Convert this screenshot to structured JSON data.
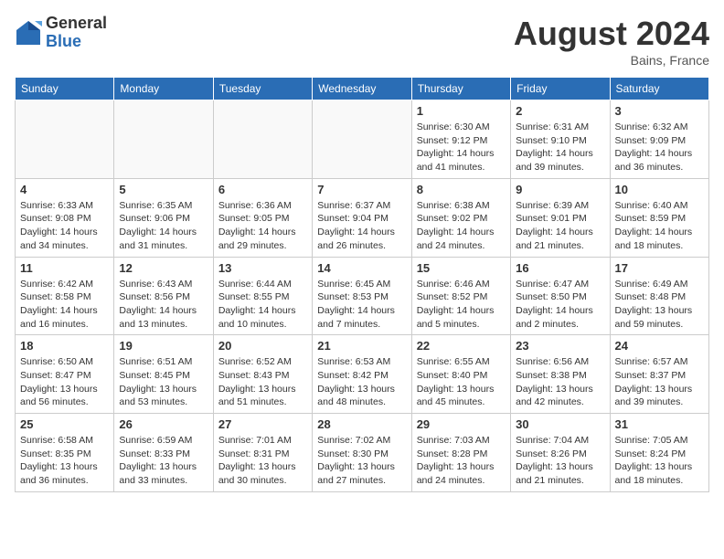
{
  "logo": {
    "general": "General",
    "blue": "Blue"
  },
  "title": "August 2024",
  "location": "Bains, France",
  "days_of_week": [
    "Sunday",
    "Monday",
    "Tuesday",
    "Wednesday",
    "Thursday",
    "Friday",
    "Saturday"
  ],
  "weeks": [
    [
      {
        "day": "",
        "info": ""
      },
      {
        "day": "",
        "info": ""
      },
      {
        "day": "",
        "info": ""
      },
      {
        "day": "",
        "info": ""
      },
      {
        "day": "1",
        "info": "Sunrise: 6:30 AM\nSunset: 9:12 PM\nDaylight: 14 hours\nand 41 minutes."
      },
      {
        "day": "2",
        "info": "Sunrise: 6:31 AM\nSunset: 9:10 PM\nDaylight: 14 hours\nand 39 minutes."
      },
      {
        "day": "3",
        "info": "Sunrise: 6:32 AM\nSunset: 9:09 PM\nDaylight: 14 hours\nand 36 minutes."
      }
    ],
    [
      {
        "day": "4",
        "info": "Sunrise: 6:33 AM\nSunset: 9:08 PM\nDaylight: 14 hours\nand 34 minutes."
      },
      {
        "day": "5",
        "info": "Sunrise: 6:35 AM\nSunset: 9:06 PM\nDaylight: 14 hours\nand 31 minutes."
      },
      {
        "day": "6",
        "info": "Sunrise: 6:36 AM\nSunset: 9:05 PM\nDaylight: 14 hours\nand 29 minutes."
      },
      {
        "day": "7",
        "info": "Sunrise: 6:37 AM\nSunset: 9:04 PM\nDaylight: 14 hours\nand 26 minutes."
      },
      {
        "day": "8",
        "info": "Sunrise: 6:38 AM\nSunset: 9:02 PM\nDaylight: 14 hours\nand 24 minutes."
      },
      {
        "day": "9",
        "info": "Sunrise: 6:39 AM\nSunset: 9:01 PM\nDaylight: 14 hours\nand 21 minutes."
      },
      {
        "day": "10",
        "info": "Sunrise: 6:40 AM\nSunset: 8:59 PM\nDaylight: 14 hours\nand 18 minutes."
      }
    ],
    [
      {
        "day": "11",
        "info": "Sunrise: 6:42 AM\nSunset: 8:58 PM\nDaylight: 14 hours\nand 16 minutes."
      },
      {
        "day": "12",
        "info": "Sunrise: 6:43 AM\nSunset: 8:56 PM\nDaylight: 14 hours\nand 13 minutes."
      },
      {
        "day": "13",
        "info": "Sunrise: 6:44 AM\nSunset: 8:55 PM\nDaylight: 14 hours\nand 10 minutes."
      },
      {
        "day": "14",
        "info": "Sunrise: 6:45 AM\nSunset: 8:53 PM\nDaylight: 14 hours\nand 7 minutes."
      },
      {
        "day": "15",
        "info": "Sunrise: 6:46 AM\nSunset: 8:52 PM\nDaylight: 14 hours\nand 5 minutes."
      },
      {
        "day": "16",
        "info": "Sunrise: 6:47 AM\nSunset: 8:50 PM\nDaylight: 14 hours\nand 2 minutes."
      },
      {
        "day": "17",
        "info": "Sunrise: 6:49 AM\nSunset: 8:48 PM\nDaylight: 13 hours\nand 59 minutes."
      }
    ],
    [
      {
        "day": "18",
        "info": "Sunrise: 6:50 AM\nSunset: 8:47 PM\nDaylight: 13 hours\nand 56 minutes."
      },
      {
        "day": "19",
        "info": "Sunrise: 6:51 AM\nSunset: 8:45 PM\nDaylight: 13 hours\nand 53 minutes."
      },
      {
        "day": "20",
        "info": "Sunrise: 6:52 AM\nSunset: 8:43 PM\nDaylight: 13 hours\nand 51 minutes."
      },
      {
        "day": "21",
        "info": "Sunrise: 6:53 AM\nSunset: 8:42 PM\nDaylight: 13 hours\nand 48 minutes."
      },
      {
        "day": "22",
        "info": "Sunrise: 6:55 AM\nSunset: 8:40 PM\nDaylight: 13 hours\nand 45 minutes."
      },
      {
        "day": "23",
        "info": "Sunrise: 6:56 AM\nSunset: 8:38 PM\nDaylight: 13 hours\nand 42 minutes."
      },
      {
        "day": "24",
        "info": "Sunrise: 6:57 AM\nSunset: 8:37 PM\nDaylight: 13 hours\nand 39 minutes."
      }
    ],
    [
      {
        "day": "25",
        "info": "Sunrise: 6:58 AM\nSunset: 8:35 PM\nDaylight: 13 hours\nand 36 minutes."
      },
      {
        "day": "26",
        "info": "Sunrise: 6:59 AM\nSunset: 8:33 PM\nDaylight: 13 hours\nand 33 minutes."
      },
      {
        "day": "27",
        "info": "Sunrise: 7:01 AM\nSunset: 8:31 PM\nDaylight: 13 hours\nand 30 minutes."
      },
      {
        "day": "28",
        "info": "Sunrise: 7:02 AM\nSunset: 8:30 PM\nDaylight: 13 hours\nand 27 minutes."
      },
      {
        "day": "29",
        "info": "Sunrise: 7:03 AM\nSunset: 8:28 PM\nDaylight: 13 hours\nand 24 minutes."
      },
      {
        "day": "30",
        "info": "Sunrise: 7:04 AM\nSunset: 8:26 PM\nDaylight: 13 hours\nand 21 minutes."
      },
      {
        "day": "31",
        "info": "Sunrise: 7:05 AM\nSunset: 8:24 PM\nDaylight: 13 hours\nand 18 minutes."
      }
    ]
  ]
}
